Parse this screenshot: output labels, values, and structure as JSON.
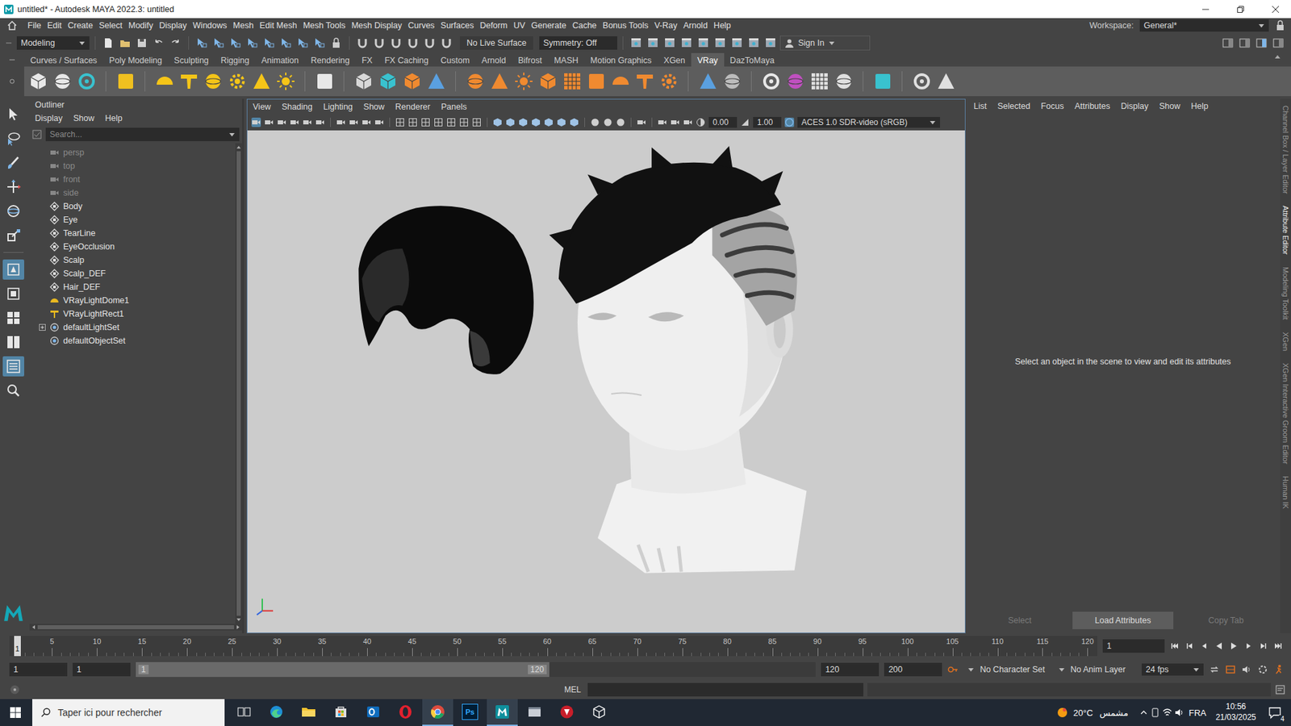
{
  "window": {
    "title": "untitled* - Autodesk MAYA 2022.3: untitled"
  },
  "menubar": {
    "items": [
      "File",
      "Edit",
      "Create",
      "Select",
      "Modify",
      "Display",
      "Windows",
      "Mesh",
      "Edit Mesh",
      "Mesh Tools",
      "Mesh Display",
      "Curves",
      "Surfaces",
      "Deform",
      "UV",
      "Generate",
      "Cache",
      "Bonus Tools",
      "V-Ray",
      "Arnold",
      "Help"
    ],
    "workspace_label": "Workspace:",
    "workspace_value": "General*"
  },
  "status_line": {
    "mode": "Modeling",
    "live_surface": "No Live Surface",
    "symmetry": "Symmetry: Off",
    "sign_in": "Sign In"
  },
  "shelf": {
    "tabs": [
      {
        "label": "Curves / Surfaces",
        "selected": false
      },
      {
        "label": "Poly Modeling",
        "selected": false
      },
      {
        "label": "Sculpting",
        "selected": false
      },
      {
        "label": "Rigging",
        "selected": false
      },
      {
        "label": "Animation",
        "selected": false
      },
      {
        "label": "Rendering",
        "selected": false
      },
      {
        "label": "FX",
        "selected": false
      },
      {
        "label": "FX Caching",
        "selected": false
      },
      {
        "label": "Custom",
        "selected": false
      },
      {
        "label": "Arnold",
        "selected": false
      },
      {
        "label": "Bifrost",
        "selected": false
      },
      {
        "label": "MASH",
        "selected": false
      },
      {
        "label": "Motion Graphics",
        "selected": false
      },
      {
        "label": "XGen",
        "selected": false
      },
      {
        "label": "VRay",
        "selected": true
      },
      {
        "label": "DazToMaya",
        "selected": false
      }
    ]
  },
  "toolbox": {
    "tools": [
      {
        "kind": "select",
        "selected": false
      },
      {
        "kind": "lasso",
        "selected": false
      },
      {
        "kind": "paint",
        "selected": false
      },
      {
        "kind": "move",
        "selected": false
      },
      {
        "kind": "rotate",
        "selected": false
      },
      {
        "kind": "scale",
        "selected": false
      }
    ],
    "layouts": [
      {
        "kind": "single",
        "selected": true
      },
      {
        "kind": "persp",
        "selected": false
      },
      {
        "kind": "four",
        "selected": false
      },
      {
        "kind": "two",
        "selected": false
      },
      {
        "kind": "outliner",
        "selected": true
      },
      {
        "kind": "search",
        "selected": false
      }
    ]
  },
  "outliner": {
    "title": "Outliner",
    "menus": [
      "Display",
      "Show",
      "Help"
    ],
    "search_placeholder": "Search...",
    "items": [
      {
        "label": "persp",
        "kind": "camera",
        "dimmed": true,
        "expandable": false
      },
      {
        "label": "top",
        "kind": "camera",
        "dimmed": true,
        "expandable": false
      },
      {
        "label": "front",
        "kind": "camera",
        "dimmed": true,
        "expandable": false
      },
      {
        "label": "side",
        "kind": "camera",
        "dimmed": true,
        "expandable": false
      },
      {
        "label": "Body",
        "kind": "mesh",
        "dimmed": false,
        "expandable": false
      },
      {
        "label": "Eye",
        "kind": "mesh",
        "dimmed": false,
        "expandable": false
      },
      {
        "label": "TearLine",
        "kind": "mesh",
        "dimmed": false,
        "expandable": false
      },
      {
        "label": "EyeOcclusion",
        "kind": "mesh",
        "dimmed": false,
        "expandable": false
      },
      {
        "label": "Scalp",
        "kind": "mesh",
        "dimmed": false,
        "expandable": false
      },
      {
        "label": "Scalp_DEF",
        "kind": "mesh",
        "dimmed": false,
        "expandable": false
      },
      {
        "label": "Hair_DEF",
        "kind": "mesh",
        "dimmed": false,
        "expandable": false
      },
      {
        "label": "VRayLightDome1",
        "kind": "dome",
        "dimmed": false,
        "expandable": false
      },
      {
        "label": "VRayLightRect1",
        "kind": "rectlight",
        "dimmed": false,
        "expandable": false
      },
      {
        "label": "defaultLightSet",
        "kind": "set",
        "dimmed": false,
        "expandable": true
      },
      {
        "label": "defaultObjectSet",
        "kind": "set",
        "dimmed": false,
        "expandable": false
      }
    ]
  },
  "viewport": {
    "menus": [
      "View",
      "Shading",
      "Lighting",
      "Show",
      "Renderer",
      "Panels"
    ],
    "exposure": "0.00",
    "gamma": "1.00",
    "color_space": "ACES 1.0 SDR-video (sRGB)"
  },
  "attribute_editor": {
    "menus": [
      "List",
      "Selected",
      "Focus",
      "Attributes",
      "Display",
      "Show",
      "Help"
    ],
    "message": "Select an object in the scene to view and edit its attributes",
    "buttons": [
      {
        "label": "Select",
        "disabled": true
      },
      {
        "label": "Load Attributes",
        "disabled": false
      },
      {
        "label": "Copy Tab",
        "disabled": true
      }
    ]
  },
  "side_tabs": [
    {
      "label": "Channel Box / Layer Editor",
      "selected": false
    },
    {
      "label": "Attribute Editor",
      "selected": true
    },
    {
      "label": "Modeling Toolkit",
      "selected": false
    },
    {
      "label": "XGen",
      "selected": false
    },
    {
      "label": "XGen Interactive Groom Editor",
      "selected": false
    },
    {
      "label": "Human IK",
      "selected": false
    }
  ],
  "time_slider": {
    "ticks": [
      "5",
      "10",
      "15",
      "20",
      "25",
      "30",
      "35",
      "40",
      "45",
      "50",
      "55",
      "60",
      "65",
      "70",
      "75",
      "80",
      "85",
      "90",
      "95",
      "100",
      "105",
      "110",
      "115",
      "120"
    ],
    "current_frame": "1",
    "frame_field": "1"
  },
  "range_slider": {
    "start": "1",
    "playback_start": "1",
    "handle_start": "1",
    "handle_end": "120",
    "playback_end": "120",
    "end": "200",
    "character_set": "No Character Set",
    "anim_layer": "No Anim Layer",
    "fps": "24 fps"
  },
  "command_line": {
    "language": "MEL"
  },
  "taskbar": {
    "search_placeholder": "Taper ici pour rechercher",
    "apps": [
      {
        "kind": "taskview",
        "active": false
      },
      {
        "kind": "edge",
        "active": false
      },
      {
        "kind": "explorer",
        "active": false
      },
      {
        "kind": "store",
        "active": false
      },
      {
        "kind": "outlook",
        "active": false
      },
      {
        "kind": "opera",
        "active": false
      },
      {
        "kind": "chrome",
        "active": true
      },
      {
        "kind": "photoshop",
        "active": false,
        "text": "Ps"
      },
      {
        "kind": "maya",
        "active": true
      },
      {
        "kind": "window",
        "active": false
      },
      {
        "kind": "red",
        "active": false
      },
      {
        "kind": "box",
        "active": false
      }
    ],
    "temperature": "20°C",
    "weather": "مشمس",
    "language": "FRA",
    "time": "10:56",
    "date": "21/03/2025",
    "notifications": "4"
  }
}
